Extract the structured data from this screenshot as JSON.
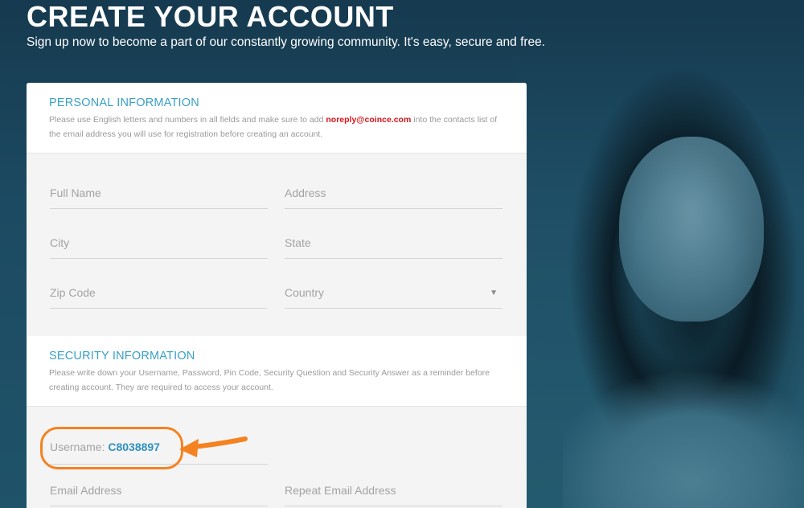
{
  "header": {
    "title": "CREATE YOUR ACCOUNT",
    "subtitle": "Sign up now to become a part of our constantly growing community. It's easy, secure and free."
  },
  "personal": {
    "title": "PERSONAL INFORMATION",
    "desc_before": "Please use English letters and numbers in all fields and make sure to add ",
    "desc_email": "noreply@coince.com",
    "desc_after": " into the contacts list of the email address you will use for registration before creating an account.",
    "fields": {
      "full_name": "Full Name",
      "address": "Address",
      "city": "City",
      "state": "State",
      "zip": "Zip Code",
      "country": "Country"
    }
  },
  "security": {
    "title": "SECURITY INFORMATION",
    "desc": "Please write down your Username, Password, Pin Code, Security Question and Security Answer as a reminder before creating account. They are required to access your account.",
    "username_label": "Username: ",
    "username_value": "C8038897",
    "email_placeholder": "Email Address",
    "repeat_email_placeholder": "Repeat Email Address"
  },
  "colors": {
    "accent": "#39a0c6",
    "highlight": "#f58220",
    "email_red": "#d7151d"
  }
}
